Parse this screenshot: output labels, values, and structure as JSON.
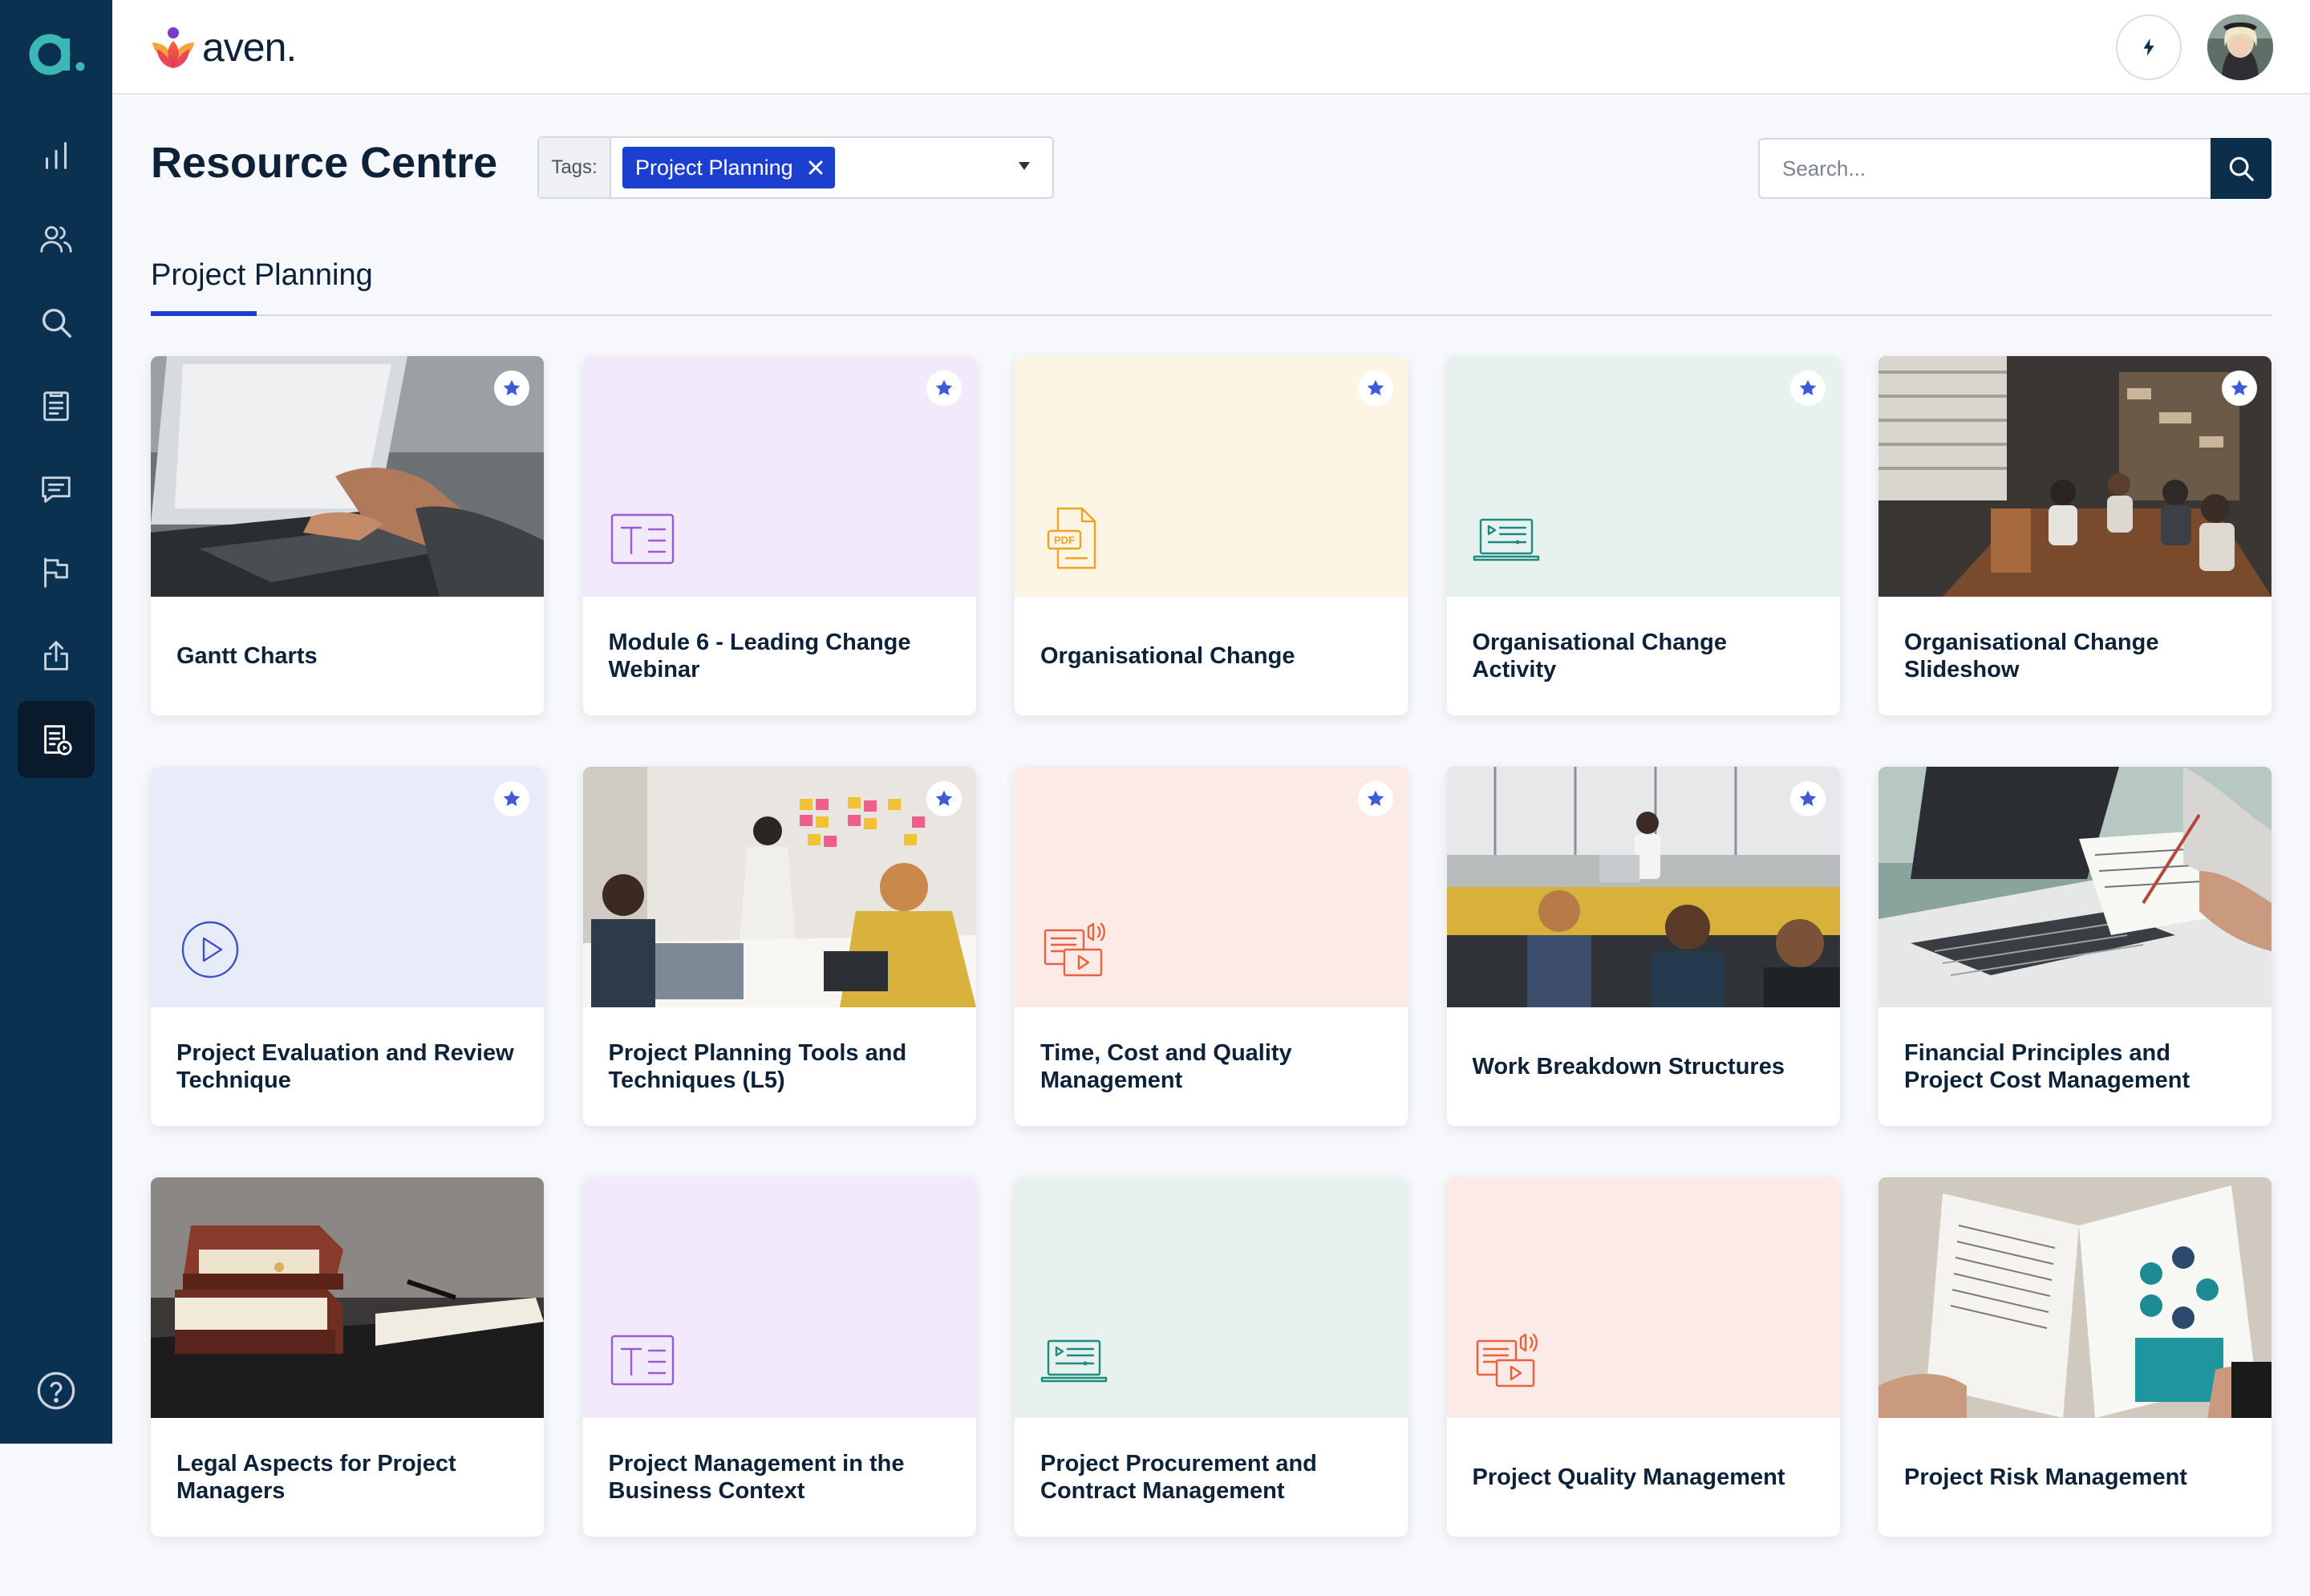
{
  "brand": {
    "name": "aven."
  },
  "sidebar": {
    "items": [
      {
        "name": "analytics",
        "icon": "bar-chart-icon"
      },
      {
        "name": "users",
        "icon": "users-icon"
      },
      {
        "name": "search",
        "icon": "search-icon"
      },
      {
        "name": "clipboard",
        "icon": "clipboard-icon"
      },
      {
        "name": "messages",
        "icon": "chat-icon"
      },
      {
        "name": "goals",
        "icon": "flag-icon"
      },
      {
        "name": "upload",
        "icon": "upload-icon"
      },
      {
        "name": "resources",
        "icon": "resource-document-icon",
        "active": true
      }
    ],
    "help_icon": "help-icon"
  },
  "header": {
    "title": "Resource Centre",
    "tags_label": "Tags:",
    "selected_tag": "Project Planning",
    "search_placeholder": "Search..."
  },
  "section": {
    "tab": "Project Planning"
  },
  "cards": [
    {
      "title": "Gantt Charts",
      "media": "photo-laptop-typing",
      "starred": true
    },
    {
      "title": "Module 6 - Leading Change Webinar",
      "media": "text-icon",
      "bg": "#f2e9fb",
      "accent": "#9b5bd4",
      "starred": true
    },
    {
      "title": "Organisational Change",
      "media": "pdf-icon",
      "bg": "#fdf5e3",
      "accent": "#f0a323",
      "starred": true
    },
    {
      "title": "Organisational Change Activity",
      "media": "laptop-video-icon",
      "bg": "#e7f2ef",
      "accent": "#1f8a80",
      "starred": true
    },
    {
      "title": "Organisational Change Slideshow",
      "media": "photo-office-meeting",
      "starred": true
    },
    {
      "title": "Project Evaluation and Review Technique",
      "media": "play-icon",
      "bg": "#e8ecf8",
      "accent": "#3d52c4",
      "starred": true
    },
    {
      "title": "Project Planning Tools and Techniques (L5)",
      "media": "photo-sticky-notes",
      "starred": true
    },
    {
      "title": "Time, Cost and Quality Management",
      "media": "presentation-icon",
      "bg": "#fbeae6",
      "accent": "#e9623f",
      "starred": true
    },
    {
      "title": "Work Breakdown Structures",
      "media": "photo-team-desks",
      "starred": true
    },
    {
      "title": "Financial Principles and Project Cost Management",
      "media": "photo-laptop-notes",
      "starred": false
    },
    {
      "title": "Legal Aspects for Project Managers",
      "media": "photo-books",
      "starred": false
    },
    {
      "title": "Project Management in the Business Context",
      "media": "text-icon",
      "bg": "#f2e9fb",
      "accent": "#9b5bd4",
      "starred": false
    },
    {
      "title": "Project Procurement and Contract Management",
      "media": "laptop-video-icon",
      "bg": "#e7f2ef",
      "accent": "#1f8a80",
      "starred": false
    },
    {
      "title": "Project Quality Management",
      "media": "presentation-icon",
      "bg": "#fbeae6",
      "accent": "#e9623f",
      "starred": false
    },
    {
      "title": "Project Risk Management",
      "media": "photo-magazine",
      "starred": false
    }
  ],
  "colors": {
    "sidebar": "#0b3150",
    "accent_blue": "#1d3fd0",
    "star": "#3b5bdb"
  }
}
